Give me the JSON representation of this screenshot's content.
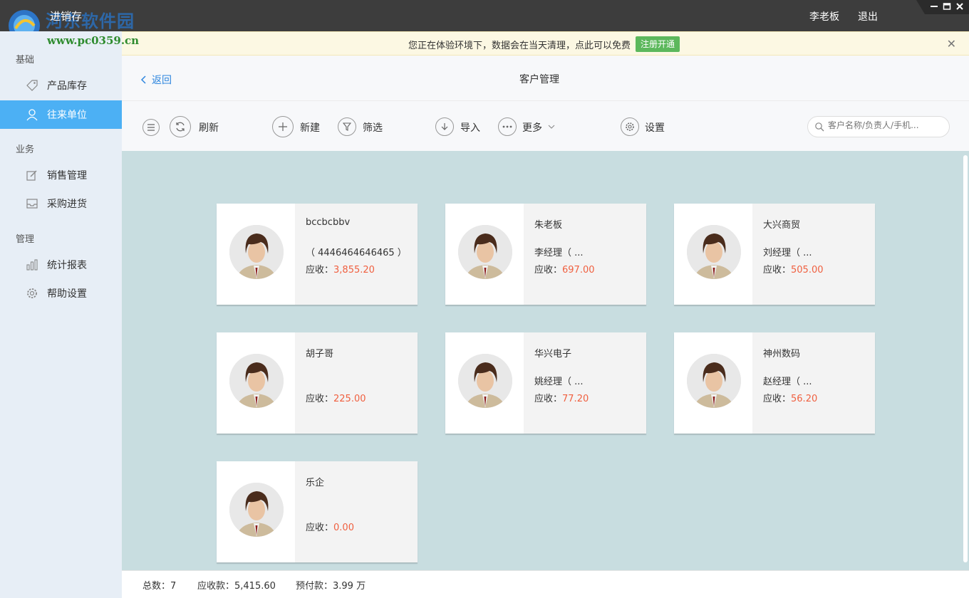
{
  "window": {
    "title": "进销存",
    "user": "李老板",
    "logout": "退出"
  },
  "watermark": {
    "brand": "河东软件园",
    "url": "www.pc0359.cn"
  },
  "sidebar": {
    "sections": [
      {
        "title": "基础",
        "items": [
          {
            "label": "产品库存",
            "icon": "tag-icon"
          },
          {
            "label": "往来单位",
            "icon": "user-icon",
            "active": true
          }
        ]
      },
      {
        "title": "业务",
        "items": [
          {
            "label": "销售管理",
            "icon": "edit-icon"
          },
          {
            "label": "采购进货",
            "icon": "inbox-icon"
          }
        ]
      },
      {
        "title": "管理",
        "items": [
          {
            "label": "统计报表",
            "icon": "bar-chart-icon"
          },
          {
            "label": "帮助设置",
            "icon": "gear-icon"
          }
        ]
      }
    ]
  },
  "notice": {
    "text": "您正在体验环境下，数据会在当天清理，点此可以免费",
    "button": "注册开通"
  },
  "header": {
    "back": "返回",
    "title": "客户管理"
  },
  "toolbar": {
    "refresh": "刷新",
    "new": "新建",
    "filter": "筛选",
    "import": "导入",
    "more": "更多",
    "settings": "设置",
    "search_placeholder": "客户名称/负责人/手机..."
  },
  "customers": [
    {
      "name": "bccbcbbv",
      "contact": "（ 4446464646465 ）",
      "recv_label": "应收：",
      "recv": "3,855.20"
    },
    {
      "name": "朱老板",
      "contact": "李经理（ ...",
      "recv_label": "应收：",
      "recv": "697.00"
    },
    {
      "name": "大兴商贸",
      "contact": "刘经理（ ...",
      "recv_label": "应收：",
      "recv": "505.00"
    },
    {
      "name": "胡子哥",
      "contact": "",
      "recv_label": "应收：",
      "recv": "225.00"
    },
    {
      "name": "华兴电子",
      "contact": "姚经理（ ...",
      "recv_label": "应收：",
      "recv": "77.20"
    },
    {
      "name": "神州数码",
      "contact": "赵经理（ ...",
      "recv_label": "应收：",
      "recv": "56.20"
    },
    {
      "name": "乐企",
      "contact": "",
      "recv_label": "应收：",
      "recv": "0.00"
    }
  ],
  "footer": {
    "total": "总数：7",
    "receivable": "应收款：5,415.60",
    "prepaid": "预付款：3.99 万"
  },
  "colors": {
    "accent": "#4cb0f4",
    "amount": "#f06040",
    "content_bg": "#c8dde0"
  }
}
